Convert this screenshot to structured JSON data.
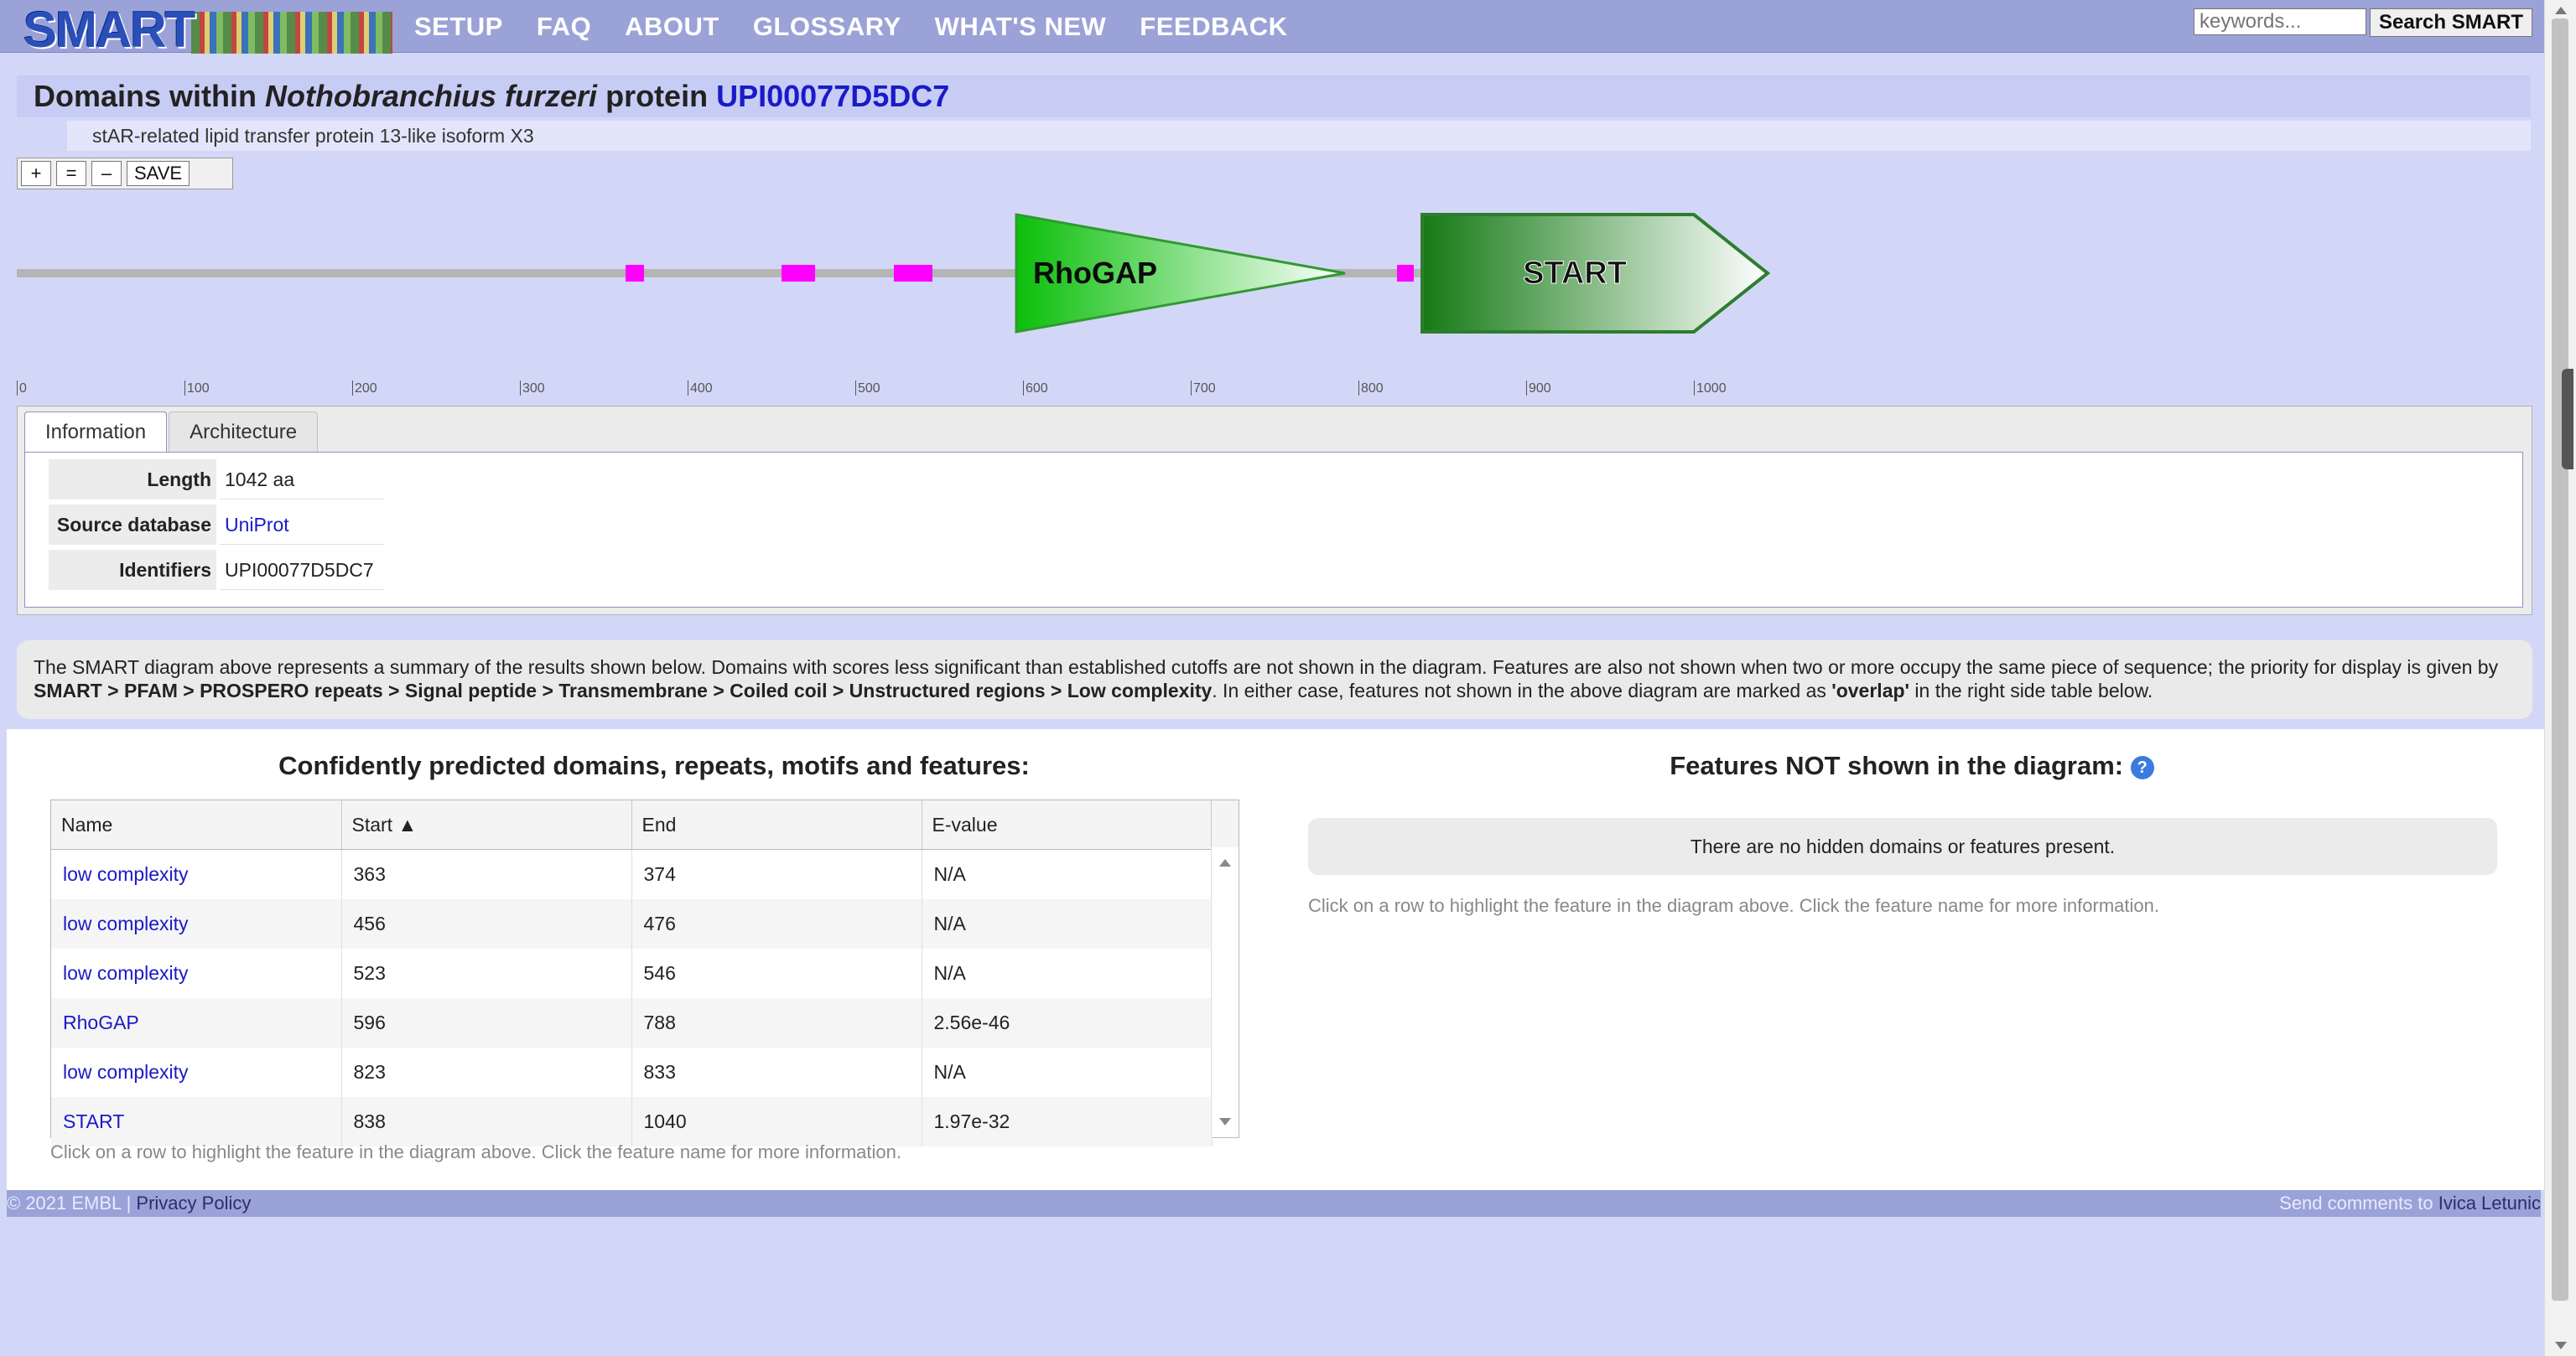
{
  "nav": {
    "logo_text": "SMART",
    "items": [
      "SETUP",
      "FAQ",
      "ABOUT",
      "GLOSSARY",
      "WHAT'S NEW",
      "FEEDBACK"
    ],
    "search_placeholder": "keywords...",
    "search_button": "Search SMART"
  },
  "heading": {
    "prefix": "Domains within",
    "species": "Nothobranchius furzeri",
    "middle": "protein",
    "protein_id": "UPI00077D5DC7",
    "subtitle": "stAR-related lipid transfer protein 13-like isoform X3"
  },
  "zoom": {
    "plus": "+",
    "equal": "=",
    "minus": "–",
    "save": "SAVE"
  },
  "diagram": {
    "protein_length": 1042,
    "scale_ticks": [
      0,
      100,
      200,
      300,
      400,
      500,
      600,
      700,
      800,
      900,
      1000
    ],
    "features": [
      {
        "name": "low complexity",
        "start": 363,
        "end": 374,
        "shape": "box",
        "color": "#ff00ff"
      },
      {
        "name": "low complexity",
        "start": 456,
        "end": 476,
        "shape": "box",
        "color": "#ff00ff"
      },
      {
        "name": "low complexity",
        "start": 523,
        "end": 546,
        "shape": "box",
        "color": "#ff00ff"
      },
      {
        "name": "RhoGAP",
        "start": 596,
        "end": 788,
        "shape": "triangle",
        "color": "#1a9a1a"
      },
      {
        "name": "low complexity",
        "start": 823,
        "end": 833,
        "shape": "box",
        "color": "#ff00ff"
      },
      {
        "name": "START",
        "start": 838,
        "end": 1040,
        "shape": "arrow",
        "color": "#1c7d1c"
      }
    ]
  },
  "info": {
    "tabs": [
      "Information",
      "Architecture"
    ],
    "rows": [
      {
        "key": "Length",
        "value": "1042 aa",
        "link": false
      },
      {
        "key": "Source database",
        "value": "UniProt",
        "link": true
      },
      {
        "key": "Identifiers",
        "value": "UPI00077D5DC7",
        "link": false
      }
    ]
  },
  "note": {
    "text1": "The SMART diagram above represents a summary of the results shown below. Domains with scores less significant than established cutoffs are not shown in the diagram. Features are also not shown when two or more occupy the same piece of sequence; the priority for display is given by ",
    "priority": "SMART > PFAM > PROSPERO repeats > Signal peptide > Transmembrane > Coiled coil > Unstructured regions > Low complexity",
    "text2": ". In either case, features not shown in the above diagram are marked as ",
    "overlap": "'overlap'",
    "text3": " in the right side table below."
  },
  "results": {
    "left_title": "Confidently predicted domains, repeats, motifs and features:",
    "columns": [
      "Name",
      "Start ▲",
      "End",
      "E-value"
    ],
    "rows": [
      {
        "name": "low complexity",
        "start": "363",
        "end": "374",
        "evalue": "N/A"
      },
      {
        "name": "low complexity",
        "start": "456",
        "end": "476",
        "evalue": "N/A"
      },
      {
        "name": "low complexity",
        "start": "523",
        "end": "546",
        "evalue": "N/A"
      },
      {
        "name": "RhoGAP",
        "start": "596",
        "end": "788",
        "evalue": "2.56e-46"
      },
      {
        "name": "low complexity",
        "start": "823",
        "end": "833",
        "evalue": "N/A"
      },
      {
        "name": "START",
        "start": "838",
        "end": "1040",
        "evalue": "1.97e-32"
      }
    ],
    "hint": "Click on a row to highlight the feature in the diagram above. Click the feature name for more information.",
    "right_title": "Features NOT shown in the diagram:",
    "help_glyph": "?",
    "no_hidden": "There are no hidden domains or features present.",
    "right_hint": "Click on a row to highlight the feature in the diagram above. Click the feature name for more information."
  },
  "footer": {
    "copyright": "© 2021 EMBL",
    "privacy": "Privacy Policy",
    "comments_prefix": "Send comments to",
    "comments_name": "Ivica Letunic"
  }
}
